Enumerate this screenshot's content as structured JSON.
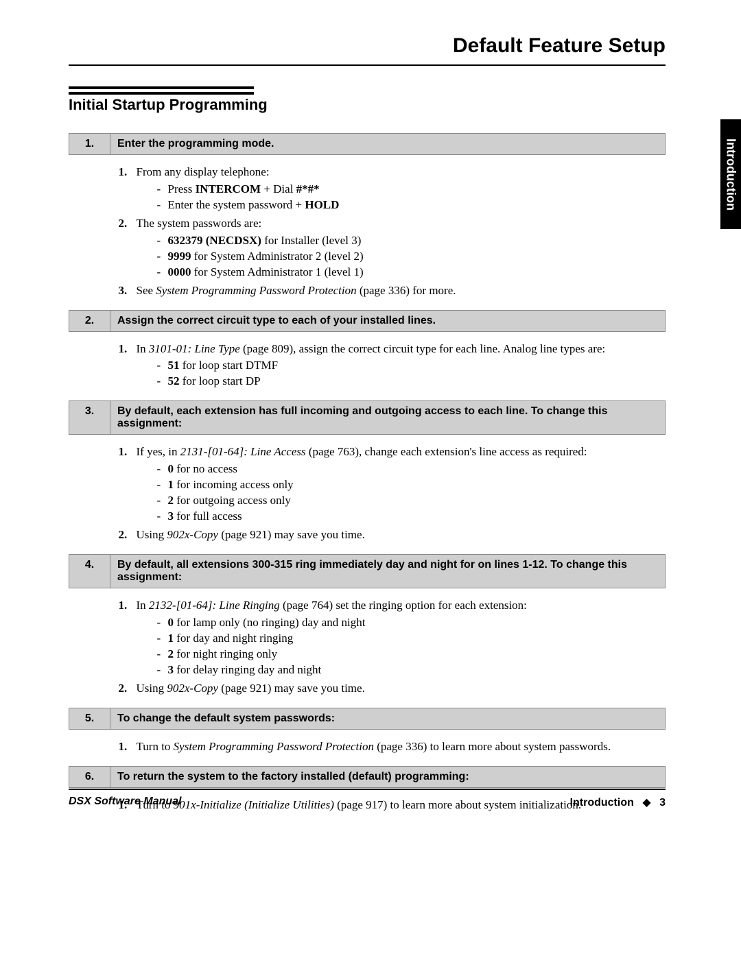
{
  "header": {
    "title": "Default Feature Setup"
  },
  "section": {
    "heading": "Initial Startup Programming"
  },
  "side_tab": "Introduction",
  "steps": [
    {
      "num": "1.",
      "title": "Enter the programming mode.",
      "items": [
        {
          "lead": "From any display telephone:",
          "subs": [
            {
              "pre": "Press ",
              "b": "INTERCOM",
              "post": " + Dial ",
              "b2": "#*#*"
            },
            {
              "pre": "Enter the system password + ",
              "b": "HOLD"
            }
          ]
        },
        {
          "lead": "The system passwords are:",
          "subs": [
            {
              "b": "632379 (NECDSX)",
              "post": " for Installer (level 3)"
            },
            {
              "b": "9999",
              "post": " for System Administrator 2 (level 2)"
            },
            {
              "b": "0000",
              "post": " for System Administrator 1 (level 1)"
            }
          ]
        },
        {
          "lead_pre": "See ",
          "lead_ital": "System Programming Password Protection",
          "lead_post": " (page 336) for more."
        }
      ]
    },
    {
      "num": "2.",
      "title": "Assign the correct circuit type to each of your installed lines.",
      "items": [
        {
          "lead_pre": "In ",
          "lead_ital": "3101-01: Line Type",
          "lead_post": " (page 809), assign the correct circuit type for each line. Analog line types are:",
          "subs": [
            {
              "b": "51",
              "post": " for loop start DTMF"
            },
            {
              "b": "52",
              "post": " for loop start DP"
            }
          ]
        }
      ]
    },
    {
      "num": "3.",
      "title": "By default, each extension has full incoming and outgoing access to each line. To change this assignment:",
      "items": [
        {
          "lead_pre": "If yes, in ",
          "lead_ital": "2131-[01-64]: Line Access",
          "lead_post": " (page 763), change each extension's line access as required:",
          "subs": [
            {
              "b": "0",
              "post": " for no access"
            },
            {
              "b": "1",
              "post": " for incoming access only"
            },
            {
              "b": "2",
              "post": " for outgoing access only"
            },
            {
              "b": "3",
              "post": " for full access"
            }
          ]
        },
        {
          "lead_pre": "Using ",
          "lead_ital": "902x-Copy",
          "lead_post": " (page 921) may save you time."
        }
      ]
    },
    {
      "num": "4.",
      "title": "By default, all extensions 300-315 ring immediately day and night for on lines 1-12. To change this assignment:",
      "items": [
        {
          "lead_pre": "In ",
          "lead_ital": "2132-[01-64]: Line Ringing",
          "lead_post": " (page 764) set the ringing option for each extension:",
          "subs": [
            {
              "b": "0",
              "post": " for lamp only (no ringing) day and night"
            },
            {
              "b": "1",
              "post": " for day and night ringing"
            },
            {
              "b": "2",
              "post": " for night ringing only"
            },
            {
              "b": "3",
              "post": " for delay ringing day and night"
            }
          ]
        },
        {
          "lead_pre": "Using ",
          "lead_ital": "902x-Copy",
          "lead_post": " (page 921) may save you time."
        }
      ]
    },
    {
      "num": "5.",
      "title": "To change the default system passwords:",
      "items": [
        {
          "lead_pre": "Turn to ",
          "lead_ital": "System Programming Password Protection",
          "lead_post": " (page 336) to learn more about system passwords."
        }
      ]
    },
    {
      "num": "6.",
      "title": "To return the system to the factory installed (default) programming:",
      "items": [
        {
          "lead_pre": "Turn to ",
          "lead_ital": "901x-Initialize (Initialize Utilities)",
          "lead_post": " (page 917) to learn more about system initialization."
        }
      ]
    }
  ],
  "footer": {
    "left": "DSX Software Manual",
    "right_label": "Introduction",
    "diamond": "◆",
    "page_num": "3"
  }
}
